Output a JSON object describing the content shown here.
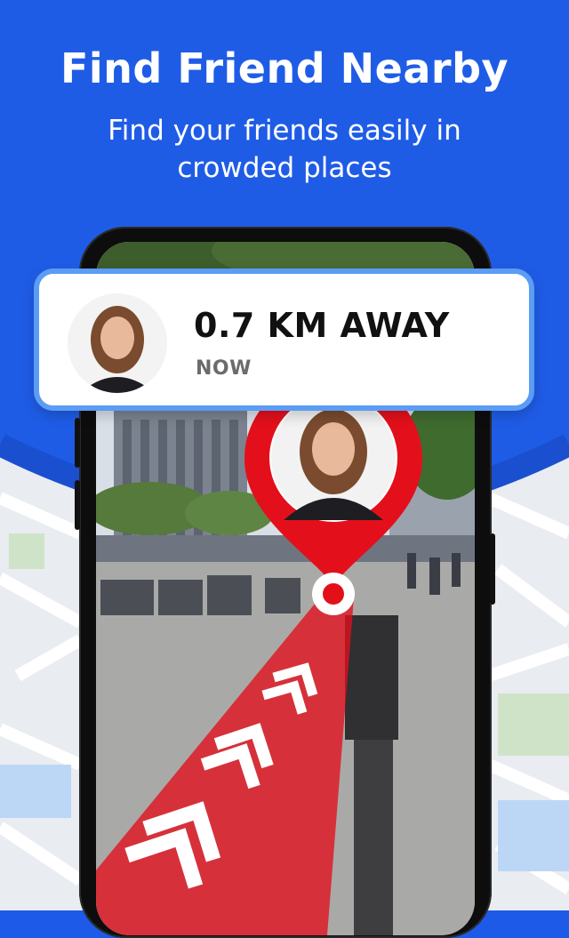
{
  "header": {
    "title": "Find Friend Nearby",
    "subtitle": "Find your friends easily in crowded places"
  },
  "card": {
    "distance": "0.7 KM AWAY",
    "time": "NOW"
  },
  "icons": {
    "map_pin": "map-pin-icon",
    "direction_arrows": "chevron-up-icon"
  },
  "colors": {
    "brand_blue": "#1f5ce6",
    "card_border": "#5b9cf5",
    "pin_red": "#e3101b"
  }
}
